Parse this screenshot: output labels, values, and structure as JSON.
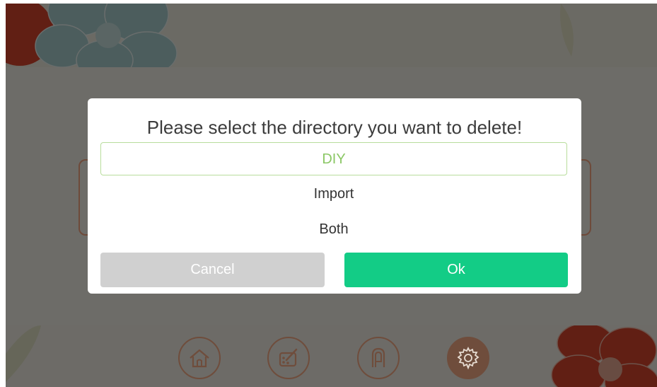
{
  "dialog": {
    "title": "Please select the directory you want to delete!",
    "options": [
      {
        "label": "DIY",
        "selected": true
      },
      {
        "label": "Import",
        "selected": false
      },
      {
        "label": "Both",
        "selected": false
      }
    ],
    "cancel_label": "Cancel",
    "ok_label": "Ok"
  },
  "bottom_nav": [
    {
      "icon": "home-icon",
      "active": false
    },
    {
      "icon": "palette-icon",
      "active": false
    },
    {
      "icon": "finger-icon",
      "active": false
    },
    {
      "icon": "gear-icon",
      "active": true
    }
  ],
  "colors": {
    "accent_ok": "#13cc86",
    "selected_text": "#8bc765",
    "nav_brown": "#6f4d3c"
  }
}
